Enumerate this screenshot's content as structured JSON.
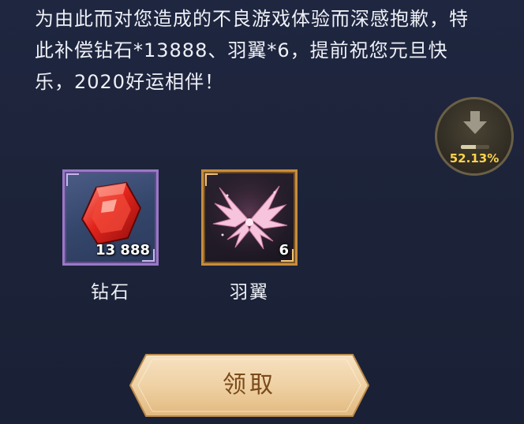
{
  "message": {
    "text": "为由此而对您造成的不良游戏体验而深感抱歉，特此补偿钻石*13888、羽翼*6，提前祝您元旦快乐，2020好运相伴！"
  },
  "progress": {
    "percent_label": "52.13%",
    "fraction": 0.5213,
    "icon": "download-arrow-icon"
  },
  "rewards": [
    {
      "name": "钻石",
      "quantity": "13 888",
      "icon": "red-diamond-icon",
      "rarity_color": "#9a78c6"
    },
    {
      "name": "羽翼",
      "quantity": "6",
      "icon": "pink-wings-icon",
      "rarity_color": "#c98c3c"
    }
  ],
  "claim_button": {
    "label": "领取"
  },
  "colors": {
    "background": "#1c2339",
    "text": "#eef0f6",
    "progress_text": "#ffd34a",
    "button_fill": "#f1d6ad",
    "button_text": "#7a4a1a"
  }
}
